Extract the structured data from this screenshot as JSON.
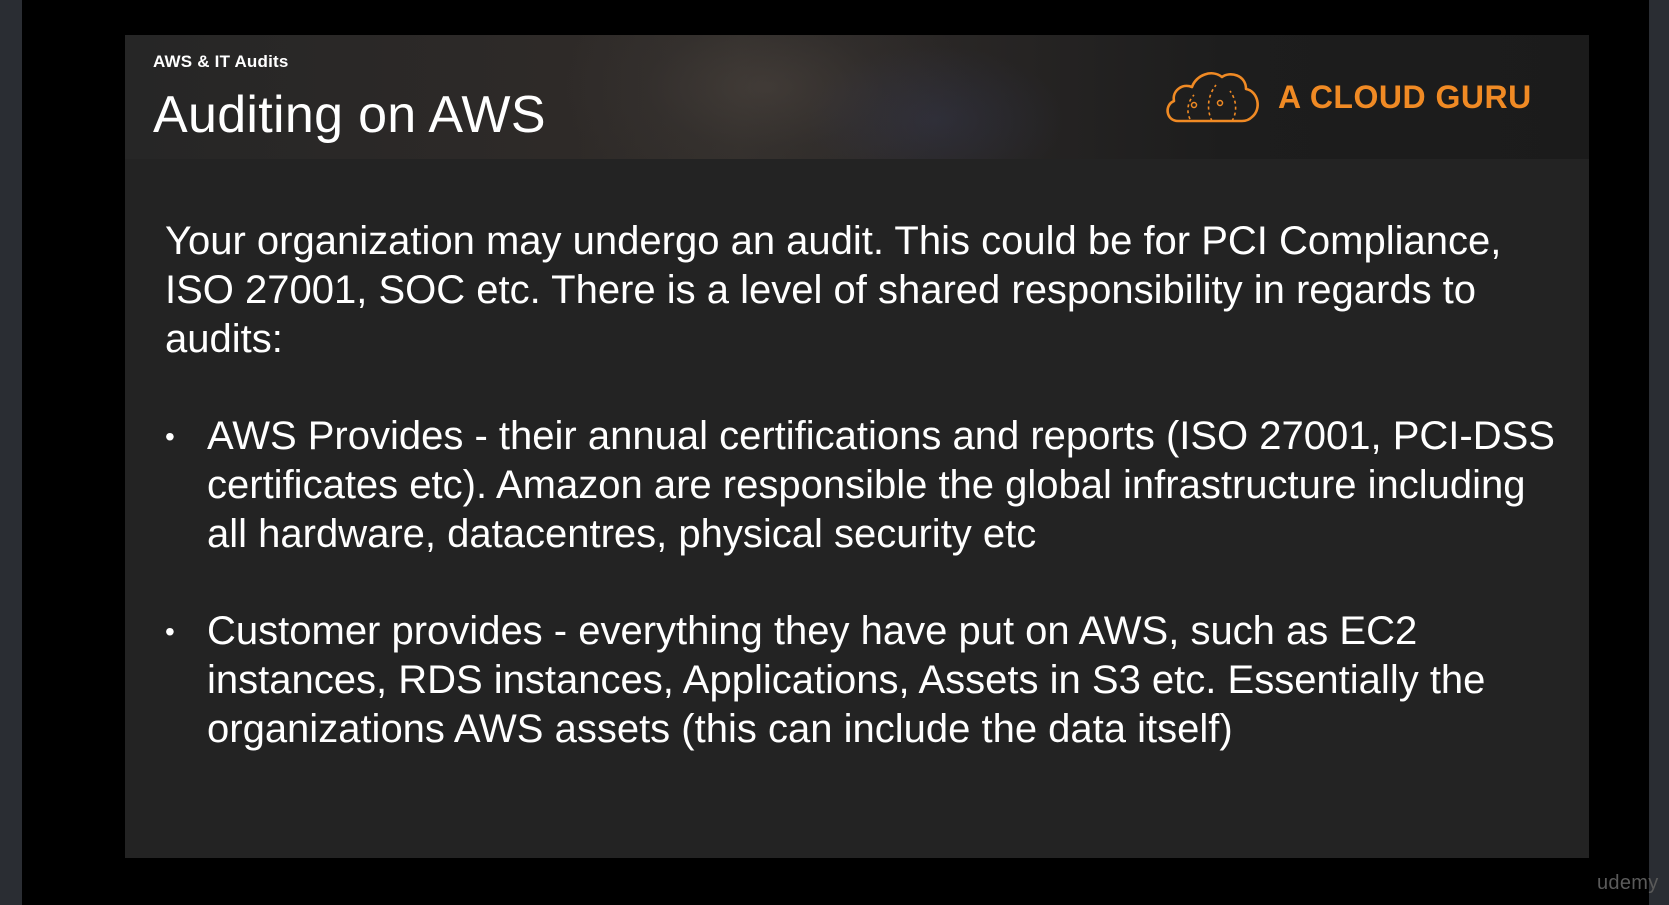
{
  "slide": {
    "eyebrow": "AWS & IT Audits",
    "title": "Auditing on AWS",
    "brand": {
      "name": "A CLOUD GURU",
      "logo_icon": "cloud-logo-icon",
      "accent_color": "#f08a24"
    },
    "intro": "Your organization may undergo an audit. This could be for PCI Compliance, ISO 27001, SOC etc. There is a level of shared responsibility in regards to audits:",
    "bullets": [
      {
        "marker": "•",
        "text": "AWS Provides - their annual certifications and reports (ISO 27001, PCI-DSS certificates etc). Amazon are responsible the global infrastructure including all hardware, datacentres, physical security etc"
      },
      {
        "marker": "•",
        "text": "Customer provides - everything they have put on AWS, such as EC2 instances, RDS instances, Applications, Assets in S3 etc. Essentially the organizations AWS assets (this can include the data itself)"
      }
    ]
  },
  "watermark": "udemy"
}
